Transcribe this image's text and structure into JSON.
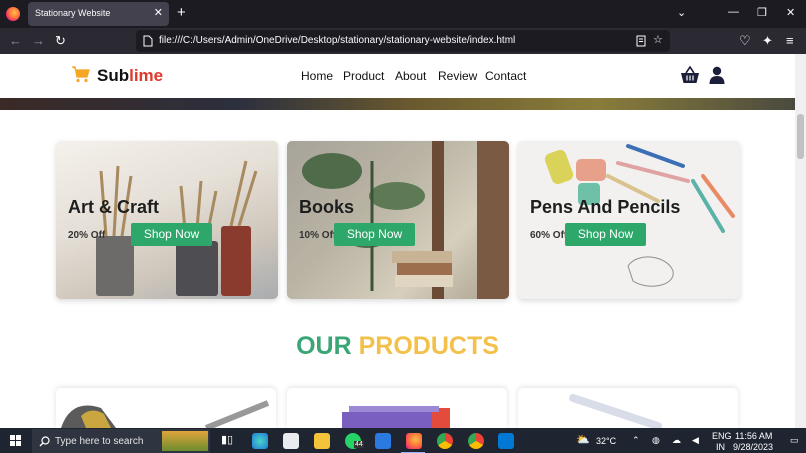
{
  "browser": {
    "tab_title": "Stationary Website",
    "tab_close": "✕",
    "new_tab": "+",
    "url": "file:///C:/Users/Admin/OneDrive/Desktop/stationary/stationary-website/index.html",
    "window_controls": [
      "⌄",
      "—",
      "❐",
      "✕"
    ]
  },
  "site": {
    "brand_first": "Sub",
    "brand_accent": "lime",
    "nav": [
      "Home",
      "Product",
      "About",
      "Review",
      "Contact"
    ]
  },
  "categories": [
    {
      "title": "Art & Craft",
      "discount": "20% Off",
      "button": "Shop Now"
    },
    {
      "title": "Books",
      "discount": "10% Off",
      "button": "Shop Now"
    },
    {
      "title": "Pens And Pencils",
      "discount": "60% Off",
      "button": "Shop Now"
    }
  ],
  "section": {
    "title_part1": "OUR",
    "title_part2": "PRODUCTS"
  },
  "taskbar": {
    "search_placeholder": "Type here to search",
    "weather": "32°C",
    "lang_line1": "ENG",
    "lang_line2": "IN",
    "time": "11:56 AM",
    "date": "9/28/2023",
    "whatsapp_badge": "44"
  },
  "colors": {
    "accent_green": "#2ea76a",
    "accent_yellow": "#f3c14b",
    "brand_red": "#e03a2d",
    "cart_yellow": "#f5a623"
  }
}
